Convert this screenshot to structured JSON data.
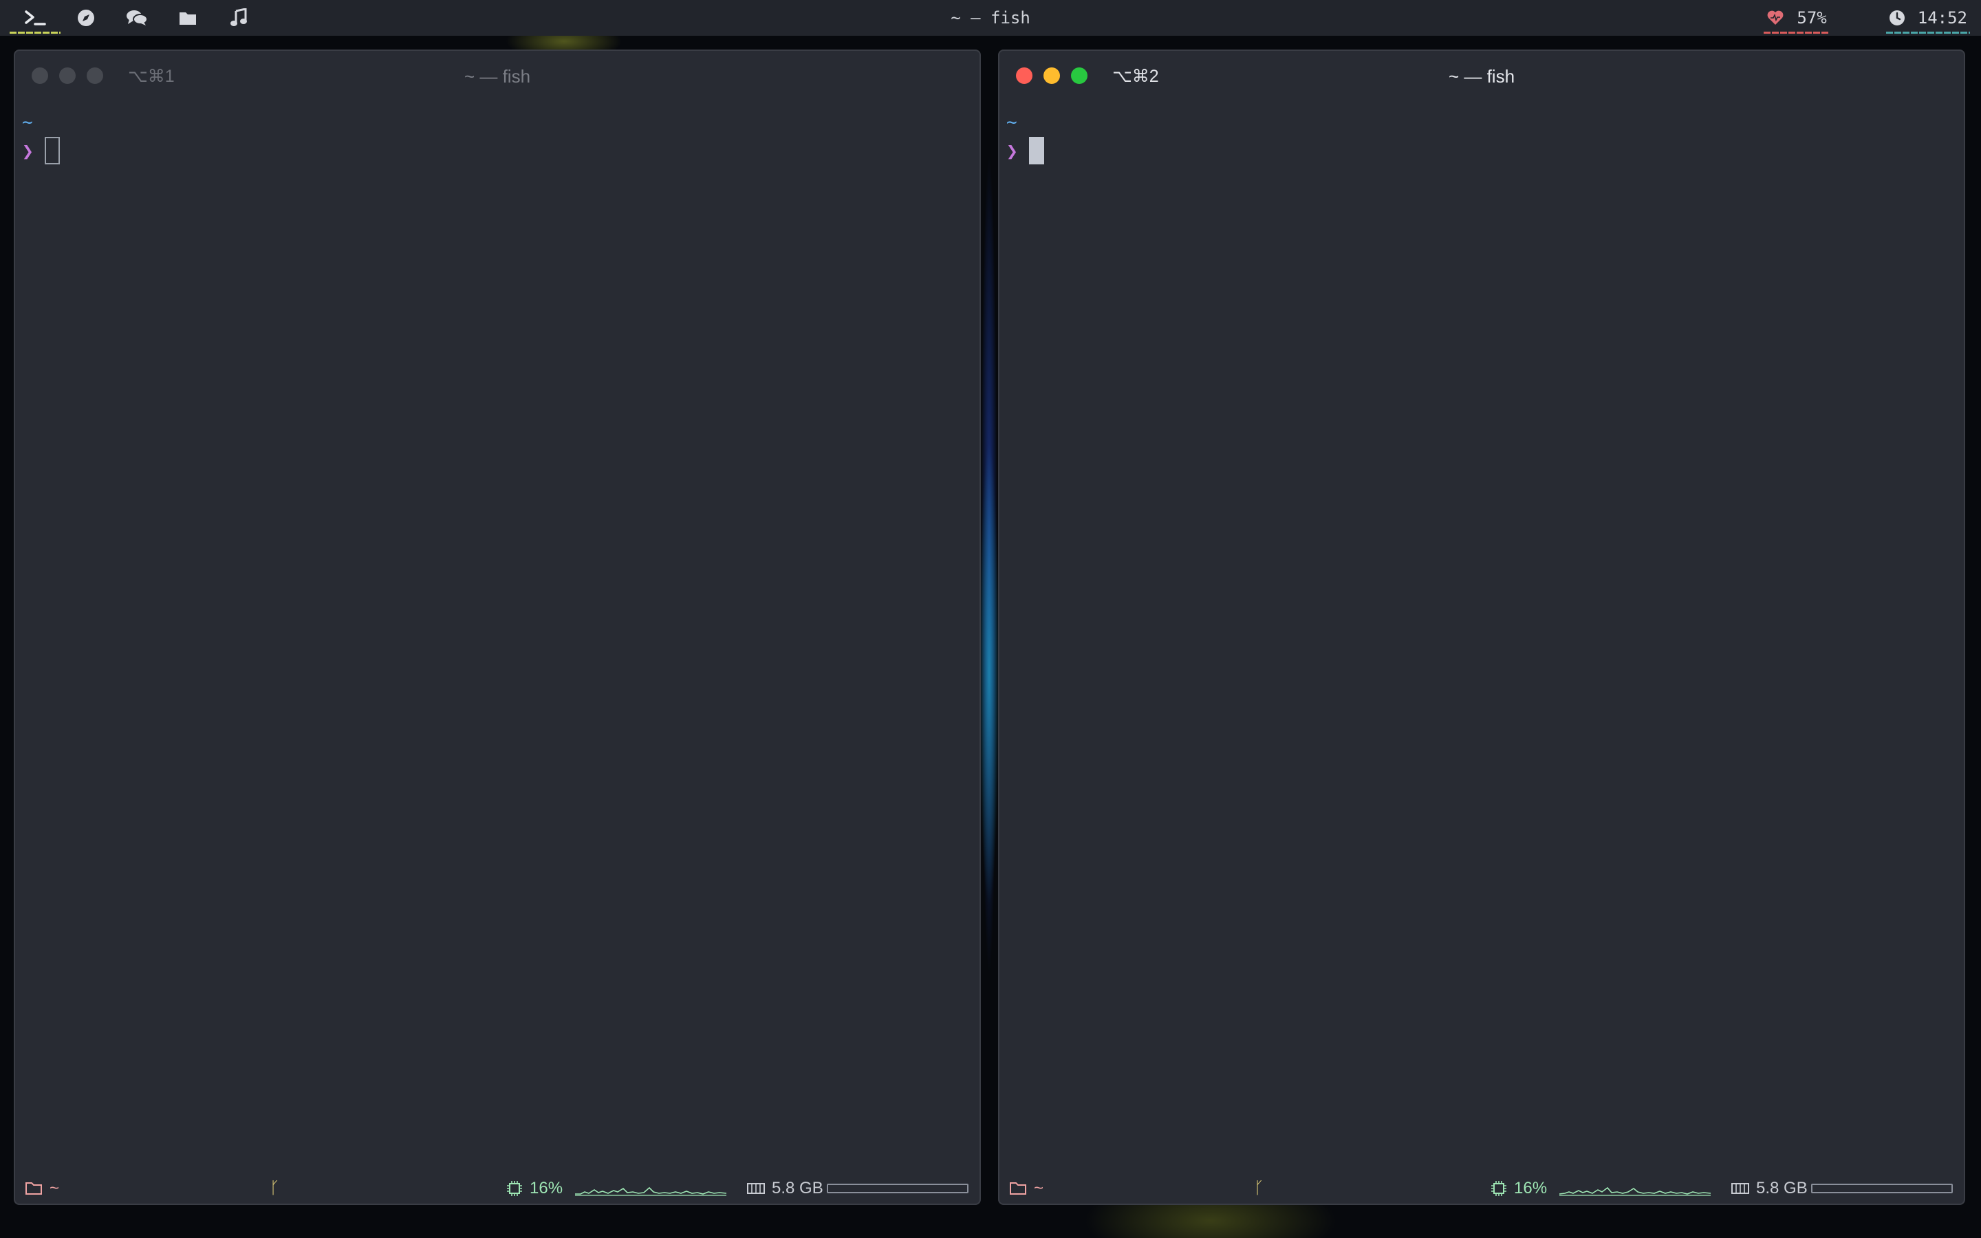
{
  "menubar": {
    "spaces": [
      {
        "icon": "terminal-icon",
        "active": true
      },
      {
        "icon": "compass-icon",
        "active": false
      },
      {
        "icon": "chat-icon",
        "active": false
      },
      {
        "icon": "folder-icon",
        "active": false
      },
      {
        "icon": "music-note-icon",
        "active": false
      }
    ],
    "title": "~ — fish",
    "battery": {
      "icon": "heart-icon",
      "value": "57%"
    },
    "clock": {
      "icon": "clock-icon",
      "value": "14:52"
    }
  },
  "windows": [
    {
      "focused": false,
      "shortcut": "⌥⌘1",
      "title": "~ — fish",
      "cwd": "~",
      "prompt_symbol": "❯",
      "status": {
        "folder": "~",
        "branch_symbol": "ᚴ",
        "cpu": "16%",
        "memory": "5.8 GB"
      }
    },
    {
      "focused": true,
      "shortcut": "⌥⌘2",
      "title": "~ — fish",
      "cwd": "~",
      "prompt_symbol": "❯",
      "status": {
        "folder": "~",
        "branch_symbol": "ᚴ",
        "cpu": "16%",
        "memory": "5.8 GB"
      }
    }
  ],
  "colors": {
    "window_bg": "#282b33",
    "cwd": "#61afef",
    "prompt": "#c678dd",
    "cpu": "#9ee6b4",
    "battery_accent": "#d95b5b",
    "clock_accent": "#4aa6a8",
    "space_accent": "#c9d35a"
  }
}
